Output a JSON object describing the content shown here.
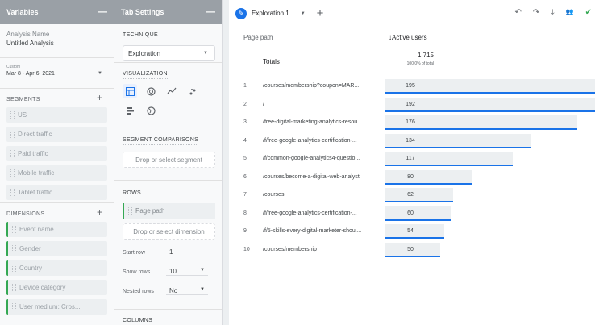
{
  "variables": {
    "header": "Variables",
    "collapse": "—",
    "analysis_name_label": "Analysis Name",
    "analysis_name": "Untitled Analysis",
    "date_label": "Custom",
    "date_range": "Mar 8 - Apr 6, 2021",
    "segments_title": "SEGMENTS",
    "segments": [
      "US",
      "Direct traffic",
      "Paid traffic",
      "Mobile traffic",
      "Tablet traffic"
    ],
    "dimensions_title": "DIMENSIONS",
    "dimensions": [
      "Event name",
      "Gender",
      "Country",
      "Device category",
      "User medium: Cros..."
    ]
  },
  "tab_settings": {
    "header": "Tab Settings",
    "collapse": "—",
    "technique_title": "TECHNIQUE",
    "technique_value": "Exploration",
    "visualization_title": "VISUALIZATION",
    "segment_comparisons_title": "SEGMENT COMPARISONS",
    "segment_drop": "Drop or select segment",
    "rows_title": "ROWS",
    "row_chip": "Page path",
    "row_drop": "Drop or select dimension",
    "start_row_label": "Start row",
    "start_row_value": "1",
    "show_rows_label": "Show rows",
    "show_rows_value": "10",
    "nested_rows_label": "Nested rows",
    "nested_rows_value": "No",
    "columns_title": "COLUMNS"
  },
  "canvas": {
    "tab_name": "Exploration 1",
    "col_dimension": "Page path",
    "col_metric": "↓Active users",
    "totals_label": "Totals",
    "totals_value": "1,715",
    "totals_pct": "100.0% of total",
    "rows": [
      {
        "n": "1",
        "path": "/courses/membership?coupon=MAR...",
        "value": 195
      },
      {
        "n": "2",
        "path": "/",
        "value": 192
      },
      {
        "n": "3",
        "path": "/free-digital-marketing-analytics-resou...",
        "value": 176
      },
      {
        "n": "4",
        "path": "/f/free-google-analytics-certification-...",
        "value": 134
      },
      {
        "n": "5",
        "path": "/f/common-google-analytics4-questio...",
        "value": 117
      },
      {
        "n": "6",
        "path": "/courses/become-a-digital-web-analyst",
        "value": 80
      },
      {
        "n": "7",
        "path": "/courses",
        "value": 62
      },
      {
        "n": "8",
        "path": "/f/free-google-analytics-certification-...",
        "value": 60
      },
      {
        "n": "9",
        "path": "/f/5-skills-every-digital-marketer-shoul...",
        "value": 54
      },
      {
        "n": "10",
        "path": "/courses/membership",
        "value": 50
      }
    ]
  },
  "icons": {
    "undo": "↶",
    "redo": "↷",
    "download": "⤓",
    "share": "👥",
    "check": "✔",
    "caret": "▼",
    "add": "+"
  }
}
